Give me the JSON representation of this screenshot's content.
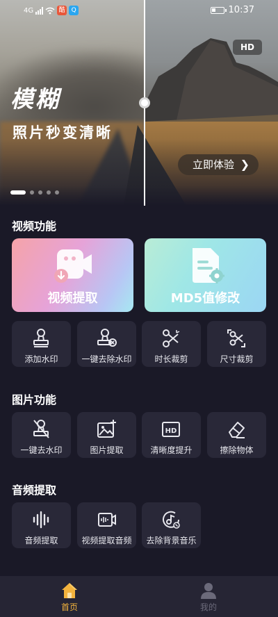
{
  "status_bar": {
    "network": "4G",
    "time": "10:37"
  },
  "hero": {
    "title": "模糊",
    "subtitle": "照片秒变清晰",
    "hd_badge": "HD",
    "cta_label": "立即体验",
    "carousel_pages": 5,
    "carousel_active_index": 0
  },
  "sections": {
    "video": {
      "title": "视频功能",
      "cards": [
        {
          "label": "视频提取",
          "icon": "video-extract-icon"
        },
        {
          "label": "MD5值修改",
          "icon": "md5-edit-icon"
        }
      ],
      "tools": [
        {
          "label": "添加水印",
          "icon": "stamp-icon"
        },
        {
          "label": "一键去除水印",
          "icon": "stamp-remove-icon"
        },
        {
          "label": "时长裁剪",
          "icon": "scissors-icon"
        },
        {
          "label": "尺寸裁剪",
          "icon": "crop-scissors-icon"
        }
      ]
    },
    "image": {
      "title": "图片功能",
      "tools": [
        {
          "label": "一键去水印",
          "icon": "stamp-off-icon"
        },
        {
          "label": "图片提取",
          "icon": "image-add-icon"
        },
        {
          "label": "清晰度提升",
          "icon": "hd-icon"
        },
        {
          "label": "擦除物体",
          "icon": "eraser-icon"
        }
      ]
    },
    "audio": {
      "title": "音频提取",
      "tools": [
        {
          "label": "音频提取",
          "icon": "waveform-icon"
        },
        {
          "label": "视频提取音频",
          "icon": "video-audio-icon"
        },
        {
          "label": "去除背景音乐",
          "icon": "music-remove-icon"
        }
      ]
    }
  },
  "bottom_nav": {
    "items": [
      {
        "label": "首页",
        "icon": "home-icon",
        "active": true
      },
      {
        "label": "我的",
        "icon": "person-icon",
        "active": false
      }
    ]
  },
  "colors": {
    "background": "#1a1927",
    "tile": "#292838",
    "nav_active": "#f3b33d",
    "nav_inactive": "#6b6a7a"
  }
}
